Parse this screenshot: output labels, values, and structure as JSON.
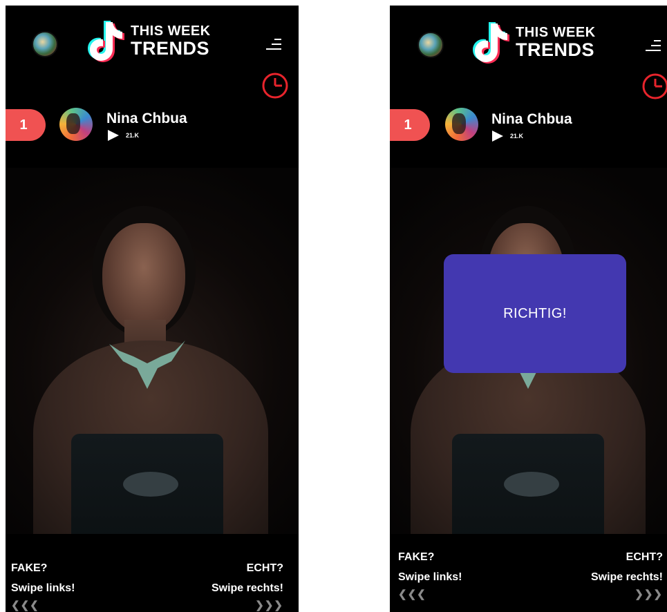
{
  "header": {
    "logo_line1": "THIS WEEK",
    "logo_line2": "TRENDS"
  },
  "icons": {
    "menu": "menu-icon",
    "timer": "clock-icon",
    "play": "play-icon"
  },
  "colors": {
    "accent": "#f05252",
    "popup": "#4338b0",
    "background": "#000000",
    "timer": "#e8242c"
  },
  "entry": {
    "rank": "1",
    "artist": "Nina Chbua",
    "plays": "21.K"
  },
  "controls": {
    "left_question": "FAKE?",
    "left_hint": "Swipe links!",
    "left_arrows": "❮❮❮",
    "right_question": "ECHT?",
    "right_hint": "Swipe rechts!",
    "right_arrows": "❯❯❯"
  },
  "feedback": {
    "message": "RICHTIG!"
  }
}
